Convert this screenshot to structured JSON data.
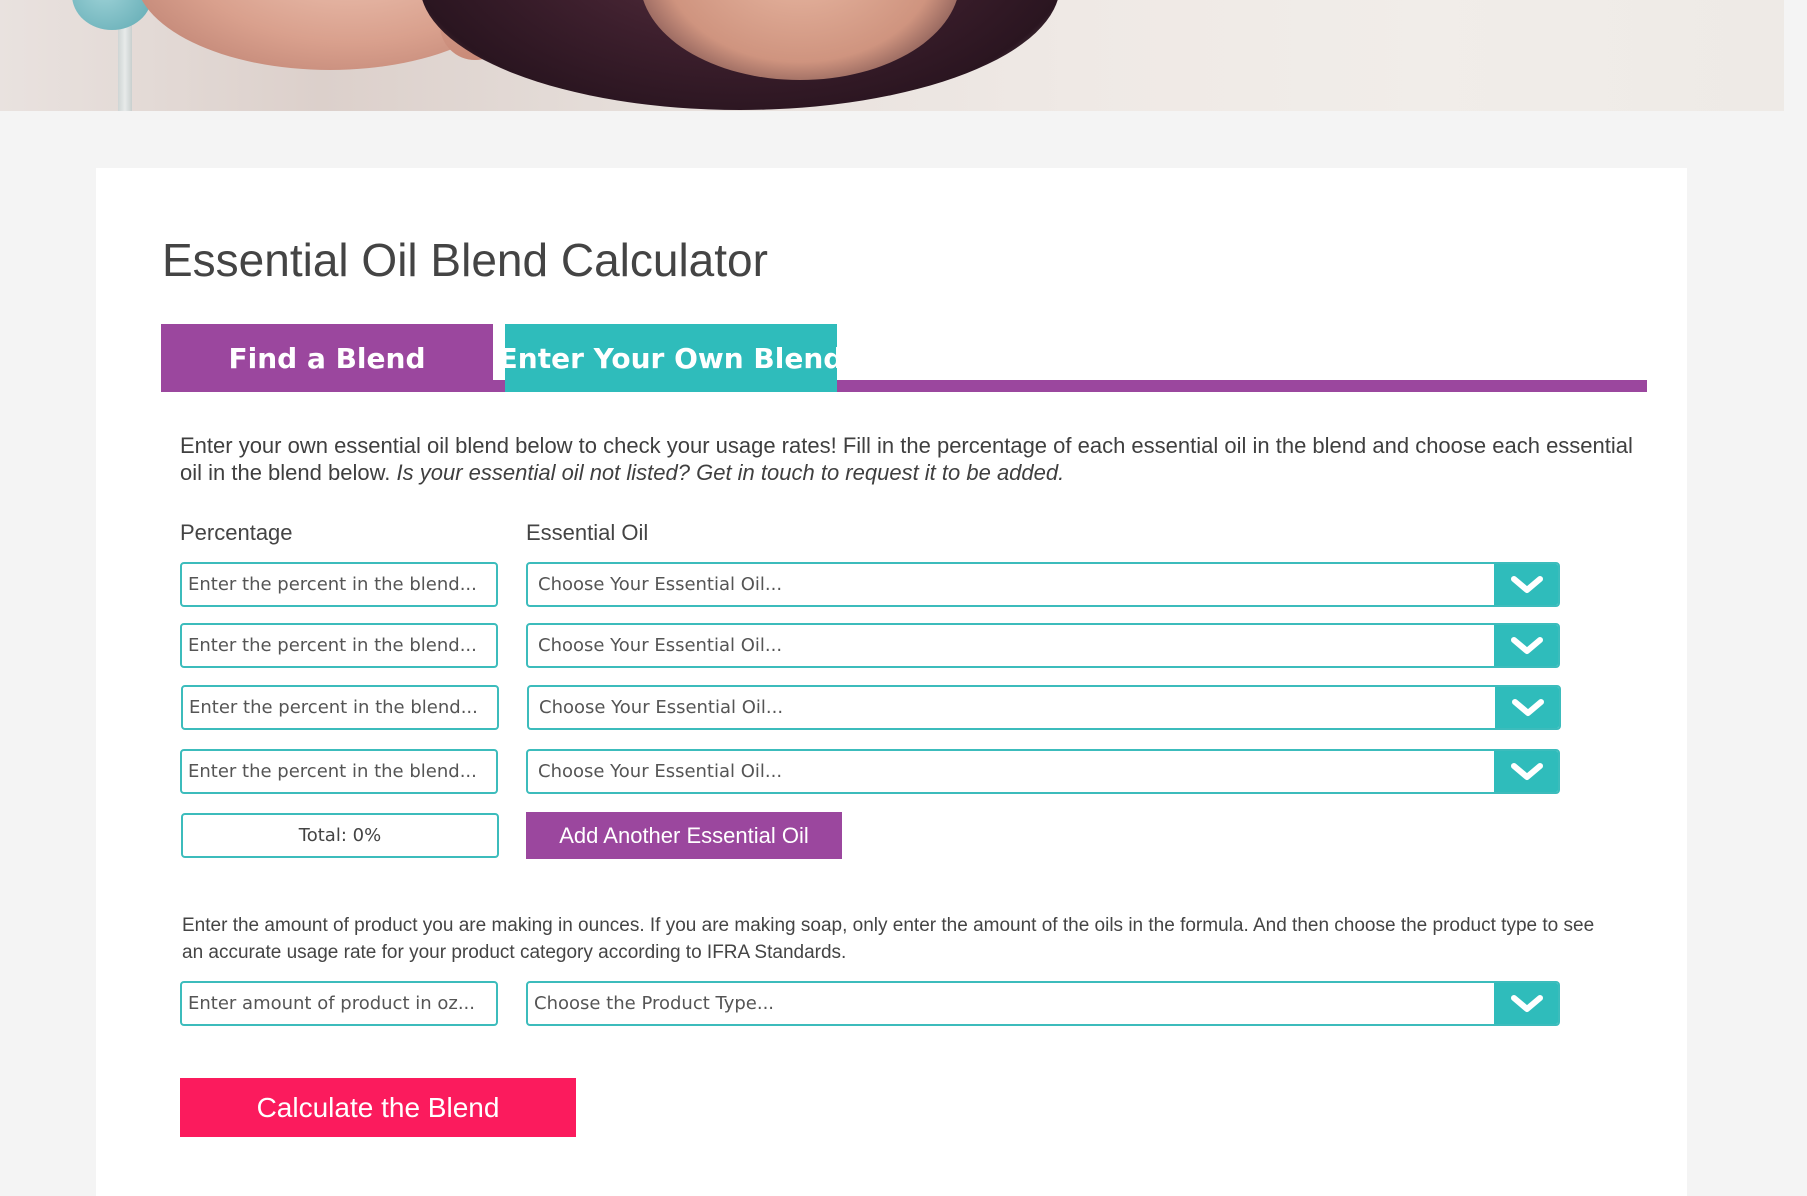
{
  "page": {
    "title": "Essential Oil Blend Calculator"
  },
  "tabs": [
    {
      "label": "Find a Blend",
      "active": false
    },
    {
      "label": "Enter Your Own Blend",
      "active": true
    }
  ],
  "intro": {
    "text": "Enter your own essential oil blend below to check your usage rates! Fill in the percentage of each essential oil in the blend and choose each essential oil in the blend below. ",
    "italic": "Is your essential oil not listed? Get in touch to request it to be added."
  },
  "columns": {
    "percentage": "Percentage",
    "essential_oil": "Essential Oil"
  },
  "rows": [
    {
      "percent_placeholder": "Enter the percent in the blend...",
      "oil_placeholder": "Choose Your Essential Oil..."
    },
    {
      "percent_placeholder": "Enter the percent in the blend...",
      "oil_placeholder": "Choose Your Essential Oil..."
    },
    {
      "percent_placeholder": "Enter the percent in the blend...",
      "oil_placeholder": "Choose Your Essential Oil..."
    },
    {
      "percent_placeholder": "Enter the percent in the blend...",
      "oil_placeholder": "Choose Your Essential Oil..."
    }
  ],
  "total": "Total: 0%",
  "add_button": "Add Another Essential Oil",
  "product": {
    "note": "Enter the amount of product you are making in ounces. If you are making soap, only enter the amount of the oils in the formula. And then choose the product type to see an accurate usage rate for your product category according to IFRA Standards.",
    "amount_placeholder": "Enter amount of product in oz...",
    "type_placeholder": "Choose the Product Type..."
  },
  "calculate_button": "Calculate the Blend",
  "icons": {
    "dropdown": "chevron-down-icon"
  },
  "colors": {
    "purple": "#9b479e",
    "teal": "#2fbcbb",
    "pink": "#fb1b5d",
    "border_teal": "#3cbcbc"
  }
}
